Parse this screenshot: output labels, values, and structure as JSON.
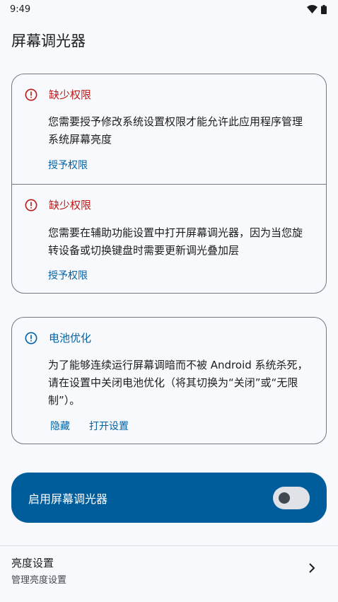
{
  "status_bar": {
    "time": "9:49"
  },
  "page": {
    "title": "屏幕调光器"
  },
  "permissions": [
    {
      "title": "缺少权限",
      "body": "您需要授予修改系统设置权限才能允许此应用程序管理系统屏幕亮度",
      "action": "授予权限"
    },
    {
      "title": "缺少权限",
      "body": "您需要在辅助功能设置中打开屏幕调光器，因为当您旋转设备或切换键盘时需要更新调光叠加层",
      "action": "授予权限"
    }
  ],
  "battery": {
    "title": "电池优化",
    "body": "为了能够连续运行屏幕调暗而不被 Android 系统杀死，请在设置中关闭电池优化（将其切换为“关闭”或“无限制”）。",
    "hide_action": "隐藏",
    "open_settings_action": "打开设置"
  },
  "dimmer_toggle": {
    "label": "启用屏幕调光器",
    "enabled": false
  },
  "brightness_item": {
    "title": "亮度设置",
    "subtitle": "管理亮度设置"
  },
  "colors": {
    "error": "#ba1a1a",
    "primary": "#0061a4",
    "toggle_bg": "#005d9c"
  },
  "icons": {
    "wifi": "wifi-icon",
    "battery": "battery-icon",
    "warning": "error-icon",
    "info": "info-icon",
    "chevron": "chevron-right-icon"
  }
}
